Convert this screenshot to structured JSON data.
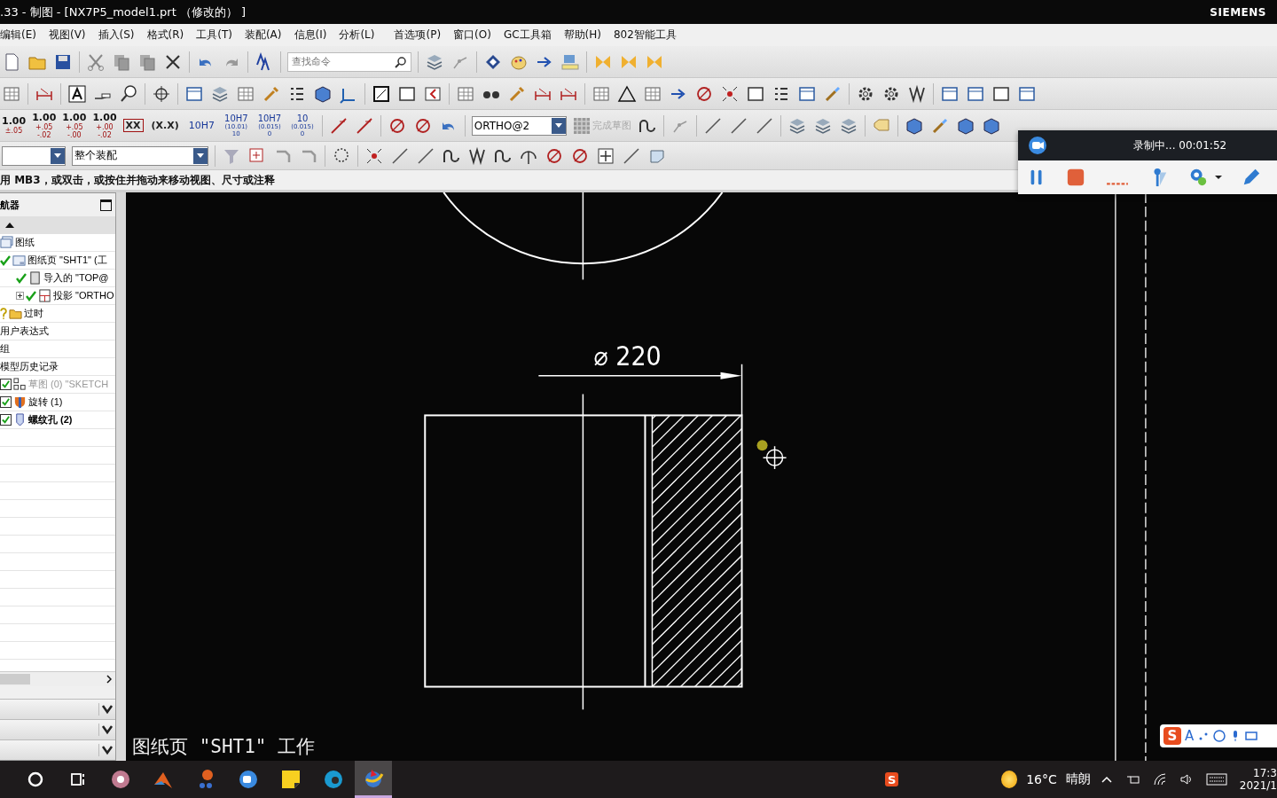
{
  "window": {
    "title": ".33 - 制图 - [NX7P5_model1.prt （修改的） ]",
    "brand": "SIEMENS"
  },
  "menu": [
    "编辑(E)",
    "视图(V)",
    "插入(S)",
    "格式(R)",
    "工具(T)",
    "装配(A)",
    "信息(I)",
    "分析(L)",
    "首选项(P)",
    "窗口(O)",
    "GC工具箱",
    "帮助(H)",
    "802智能工具"
  ],
  "toolbar": {
    "search": {
      "placeholder": "查找命令"
    },
    "tolerances": [
      {
        "main": "1.00",
        "sub": [
          "±.05"
        ]
      },
      {
        "main": "1.00",
        "sub": [
          "+.05",
          "-.02"
        ]
      },
      {
        "main": "1.00",
        "sub": [
          "+.05",
          "-.00"
        ]
      },
      {
        "main": "1.00",
        "sub": [
          "+.00",
          "-.02"
        ]
      }
    ],
    "formats": [
      {
        "kind": "boxed",
        "label": "XX"
      },
      {
        "kind": "plain",
        "label": "(X.X)"
      },
      {
        "kind": "fit",
        "label": "10H7"
      },
      {
        "kind": "stack",
        "label": "10H7",
        "sub": [
          "(10.01)",
          "10"
        ]
      },
      {
        "kind": "stack",
        "label": "10H7",
        "sub": [
          "(0.015)",
          "0"
        ]
      },
      {
        "kind": "stack",
        "label": "10",
        "sub": [
          "(0.015)",
          "0"
        ]
      }
    ],
    "view_dropdown": {
      "value": "ORTHO@2"
    },
    "finish_sketch": {
      "label": "完成草图",
      "disabled": true
    },
    "scope_dropdown": {
      "value": "整个装配"
    }
  },
  "prompt": "用 MB3，或双击，或按住并拖动来移动视图、尺寸或注释",
  "navigator": {
    "title": "航器",
    "tree": [
      {
        "kind": "sheets",
        "label": "图纸",
        "children": [
          {
            "kind": "sheet",
            "label": "图纸页 \"SHT1\" (工",
            "children": [
              {
                "kind": "imported",
                "label": "导入的 \"TOP@"
              },
              {
                "kind": "projected",
                "label": "投影 \"ORTHO",
                "expanded": false
              }
            ]
          }
        ]
      },
      {
        "kind": "outdated",
        "label": "过时"
      }
    ],
    "sections": [
      {
        "label": "用户表达式"
      },
      {
        "label": "组"
      },
      {
        "label": "模型历史记录",
        "features": [
          {
            "kind": "sketch",
            "label": "草图 (0) \"SKETCH",
            "checked": true,
            "disabled": true,
            "current": false
          },
          {
            "kind": "revolve",
            "label": "旋转 (1)",
            "checked": true,
            "disabled": false,
            "current": false
          },
          {
            "kind": "hole",
            "label": "螺纹孔 (2)",
            "checked": true,
            "disabled": false,
            "current": true
          }
        ]
      }
    ]
  },
  "drawing": {
    "dimension": "⌀ 220",
    "sheet_caption": "图纸页 \"SHT1\" 工作"
  },
  "recorder": {
    "status": "录制中... 00:01:52"
  },
  "ime": {
    "logo": "S",
    "mode": "A"
  },
  "taskbar": {
    "ime_logo": "S",
    "weather": "16°C",
    "condition": "晴朗",
    "time": "17:3",
    "date": "2021/1"
  }
}
